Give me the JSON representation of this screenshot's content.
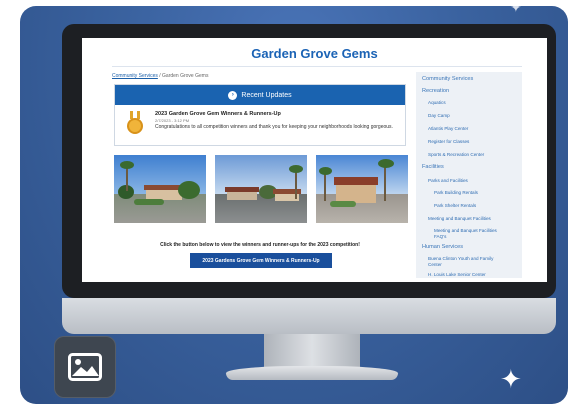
{
  "site": {
    "title": "Garden Grove Gems",
    "breadcrumb": {
      "parent": "Community Services",
      "separator": " / ",
      "current": "Garden Grove Gems"
    }
  },
  "updates": {
    "heading": "Recent Updates",
    "item": {
      "title": "2023 Garden Grove Gem Winners & Runners-Up",
      "date": "2/7/2023 - 3:12 PM",
      "description": "Congratulations to all competition winners and thank you for keeping your neighborhoods looking gorgeous."
    }
  },
  "photos": [
    {
      "icon": "house-photo"
    },
    {
      "icon": "house-photo"
    },
    {
      "icon": "house-photo"
    }
  ],
  "cta": {
    "text": "Click the button below to view the winners and runner-ups for the 2023 competition!",
    "button_label": "2023 Gardens Grove Gem Winners & Runners-Up"
  },
  "sidebar": {
    "items": [
      {
        "label": "Community Services",
        "level": "heading"
      },
      {
        "label": "Recreation",
        "level": "heading"
      },
      {
        "label": "Aquatics",
        "level": "sub"
      },
      {
        "label": "Day Camp",
        "level": "sub"
      },
      {
        "label": "Atlantis Play Center",
        "level": "sub"
      },
      {
        "label": "Register for Classes",
        "level": "sub"
      },
      {
        "label": "Sports & Recreation Center",
        "level": "sub"
      },
      {
        "label": "Facilities",
        "level": "heading"
      },
      {
        "label": "Parks and Facilities",
        "level": "sub"
      },
      {
        "label": "Park Building Rentals",
        "level": "subsub"
      },
      {
        "label": "Park Shelter Rentals",
        "level": "subsub"
      },
      {
        "label": "Meeting and Banquet Facilities",
        "level": "sub"
      },
      {
        "label": "Meeting and Banquet Facilities",
        "level": "subsub"
      },
      {
        "label": "FAQ's",
        "level": "subsub"
      },
      {
        "label": "Human Services",
        "level": "heading"
      },
      {
        "label": "Buena Clinton Youth and Family",
        "level": "sub"
      },
      {
        "label": "Center",
        "level": "sub"
      },
      {
        "label": "H. Louis Lake Senior Center",
        "level": "sub"
      }
    ]
  },
  "colors": {
    "brand_blue": "#1b63b5",
    "button_blue": "#1a4f9c",
    "background_blue": "#3a629f"
  },
  "icons": {
    "image_badge": "image-icon",
    "medal": "medal-icon",
    "update_arrow": "arrow-right-icon"
  }
}
